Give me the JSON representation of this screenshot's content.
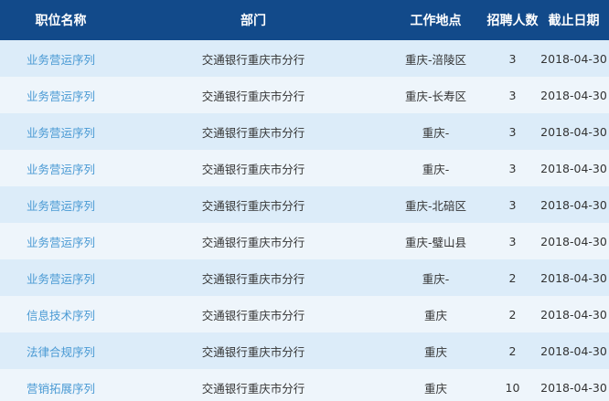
{
  "table": {
    "headers": [
      "职位名称",
      "部门",
      "工作地点",
      "招聘人数",
      "截止日期"
    ],
    "rows": [
      {
        "title": "业务营运序列",
        "dept": "交通银行重庆市分行",
        "location": "重庆-涪陵区",
        "count": "3",
        "deadline": "2018-04-30"
      },
      {
        "title": "业务营运序列",
        "dept": "交通银行重庆市分行",
        "location": "重庆-长寿区",
        "count": "3",
        "deadline": "2018-04-30"
      },
      {
        "title": "业务营运序列",
        "dept": "交通银行重庆市分行",
        "location": "重庆-",
        "count": "3",
        "deadline": "2018-04-30"
      },
      {
        "title": "业务营运序列",
        "dept": "交通银行重庆市分行",
        "location": "重庆-",
        "count": "3",
        "deadline": "2018-04-30"
      },
      {
        "title": "业务营运序列",
        "dept": "交通银行重庆市分行",
        "location": "重庆-北碚区",
        "count": "3",
        "deadline": "2018-04-30"
      },
      {
        "title": "业务营运序列",
        "dept": "交通银行重庆市分行",
        "location": "重庆-璧山县",
        "count": "3",
        "deadline": "2018-04-30"
      },
      {
        "title": "业务营运序列",
        "dept": "交通银行重庆市分行",
        "location": "重庆-",
        "count": "2",
        "deadline": "2018-04-30"
      },
      {
        "title": "信息技术序列",
        "dept": "交通银行重庆市分行",
        "location": "重庆",
        "count": "2",
        "deadline": "2018-04-30"
      },
      {
        "title": "法律合规序列",
        "dept": "交通银行重庆市分行",
        "location": "重庆",
        "count": "2",
        "deadline": "2018-04-30"
      },
      {
        "title": "营销拓展序列",
        "dept": "交通银行重庆市分行",
        "location": "重庆",
        "count": "10",
        "deadline": "2018-04-30"
      }
    ]
  },
  "colors": {
    "header_bg": "#124a8a",
    "row_odd_bg": "#dcecf9",
    "row_even_bg": "#eef5fb",
    "link": "#4a9ad4"
  }
}
